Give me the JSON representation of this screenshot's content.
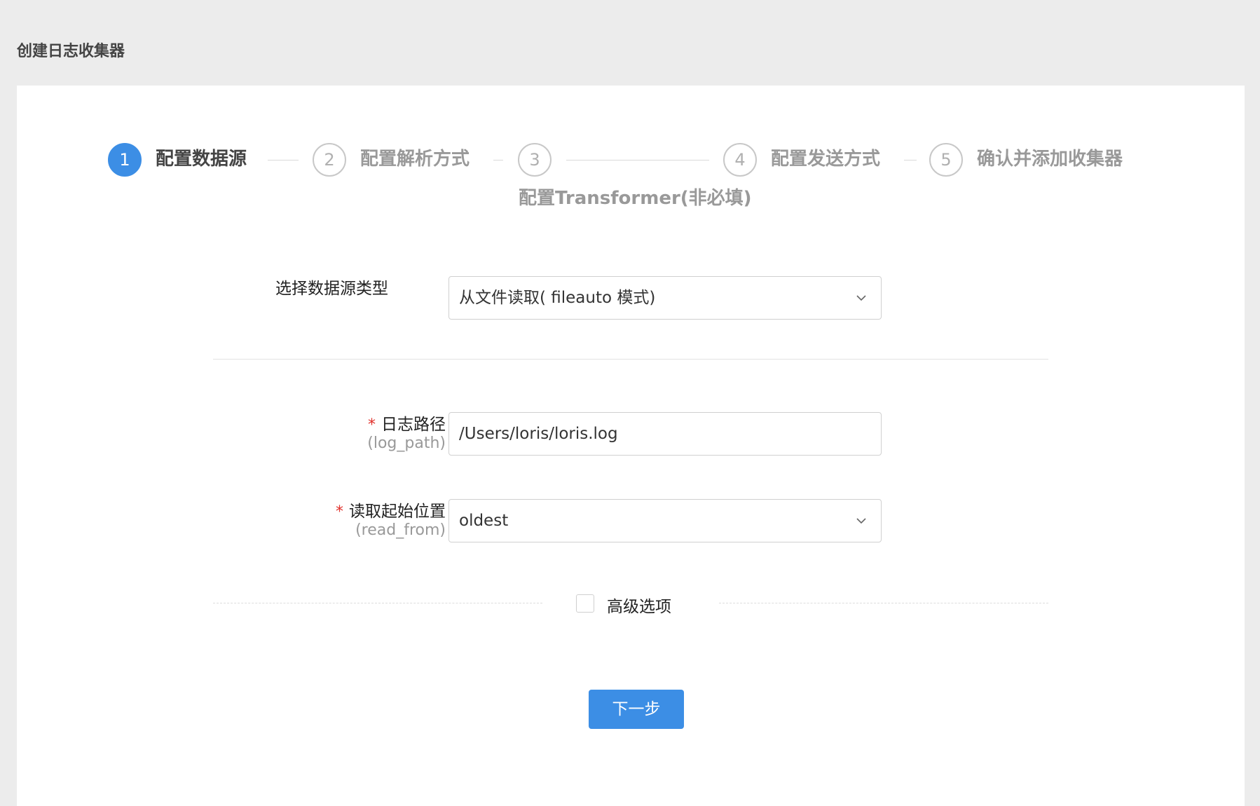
{
  "page": {
    "title": "创建日志收集器"
  },
  "steps": [
    {
      "number": "1",
      "label": "配置数据源",
      "active": true
    },
    {
      "number": "2",
      "label": "配置解析方式",
      "active": false
    },
    {
      "number": "3",
      "label": "配置Transformer(非必填)",
      "active": false
    },
    {
      "number": "4",
      "label": "配置发送方式",
      "active": false
    },
    {
      "number": "5",
      "label": "确认并添加收集器",
      "active": false
    }
  ],
  "form": {
    "source_type": {
      "label": "选择数据源类型",
      "value": "从文件读取( fileauto 模式)"
    },
    "log_path": {
      "required_mark": "*",
      "label": "日志路径",
      "sublabel": "(log_path)",
      "value": "/Users/loris/loris.log"
    },
    "read_from": {
      "required_mark": "*",
      "label": "读取起始位置",
      "sublabel": "(read_from)",
      "value": "oldest"
    },
    "advanced": {
      "label": "高级选项",
      "checked": false
    }
  },
  "actions": {
    "next_label": "下一步"
  },
  "colors": {
    "accent": "#3c8ee5",
    "required": "#e0302b",
    "background": "#ececec"
  },
  "icons": {
    "select_arrow": "chevron-down-icon"
  }
}
